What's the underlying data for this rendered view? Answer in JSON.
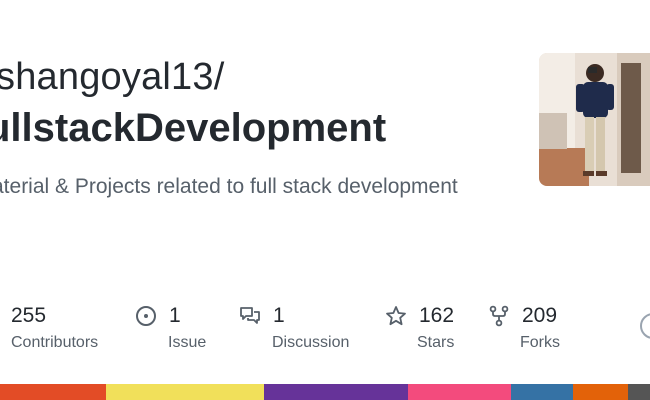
{
  "header": {
    "owner": "shangoyal13/",
    "repo_name": "ullstackDevelopment",
    "description": "aterial & Projects related to full stack development"
  },
  "avatar": {
    "alt": "owner-avatar"
  },
  "stats": {
    "contributors": {
      "count": "255",
      "label": "Contributors",
      "icon": "people-icon"
    },
    "issues": {
      "count": "1",
      "label": "Issue",
      "icon": "issue-icon"
    },
    "discussions": {
      "count": "1",
      "label": "Discussion",
      "icon": "discussion-icon"
    },
    "stars": {
      "count": "162",
      "label": "Stars",
      "icon": "star-icon"
    },
    "forks": {
      "count": "209",
      "label": "Forks",
      "icon": "fork-icon"
    }
  },
  "language_bar": {
    "colors": [
      "#e34c26",
      "#f1e05a",
      "#663399",
      "#f34b7d",
      "#3572a5",
      "#e36209",
      "#555555"
    ]
  }
}
